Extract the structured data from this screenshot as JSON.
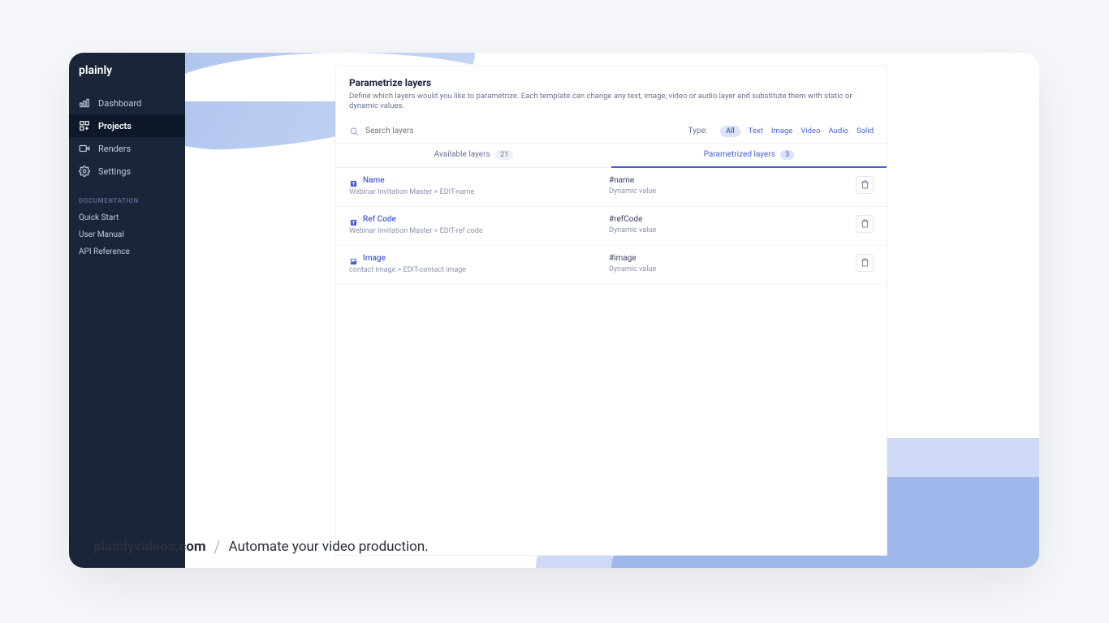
{
  "brand": "plainly",
  "sidebar": {
    "items": [
      {
        "label": "Dashboard"
      },
      {
        "label": "Projects"
      },
      {
        "label": "Renders"
      },
      {
        "label": "Settings"
      }
    ],
    "doc_header": "DOCUMENTATION",
    "docs": [
      {
        "label": "Quick Start"
      },
      {
        "label": "User Manual"
      },
      {
        "label": "API Reference"
      }
    ]
  },
  "panel": {
    "title": "Parametrize layers",
    "description": "Define which layers would you like to parametrize. Each template can change any text, image, video or audio layer and substitute them with static or dynamic values.",
    "search_placeholder": "Search layers",
    "type_label": "Type:",
    "type_filters": [
      "All",
      "Text",
      "Image",
      "Video",
      "Audio",
      "Solid"
    ],
    "tabs": {
      "available": {
        "label": "Available layers",
        "count": "21"
      },
      "parametrized": {
        "label": "Parametrized layers",
        "count": "3"
      }
    },
    "layers": [
      {
        "icon": "text",
        "name": "Name",
        "path": "Webinar Invitation Master > EDIT-name",
        "param": "#name",
        "value": "Dynamic value"
      },
      {
        "icon": "text",
        "name": "Ref Code",
        "path": "Webinar Invitation Master > EDIT-ref code",
        "param": "#refCode",
        "value": "Dynamic value"
      },
      {
        "icon": "image",
        "name": "Image",
        "path": "contact image > EDIT-contact image",
        "param": "#image",
        "value": "Dynamic value"
      }
    ]
  },
  "caption": {
    "brand": "plainlyvideos.com",
    "sep": "/",
    "tagline": "Automate your video production."
  }
}
